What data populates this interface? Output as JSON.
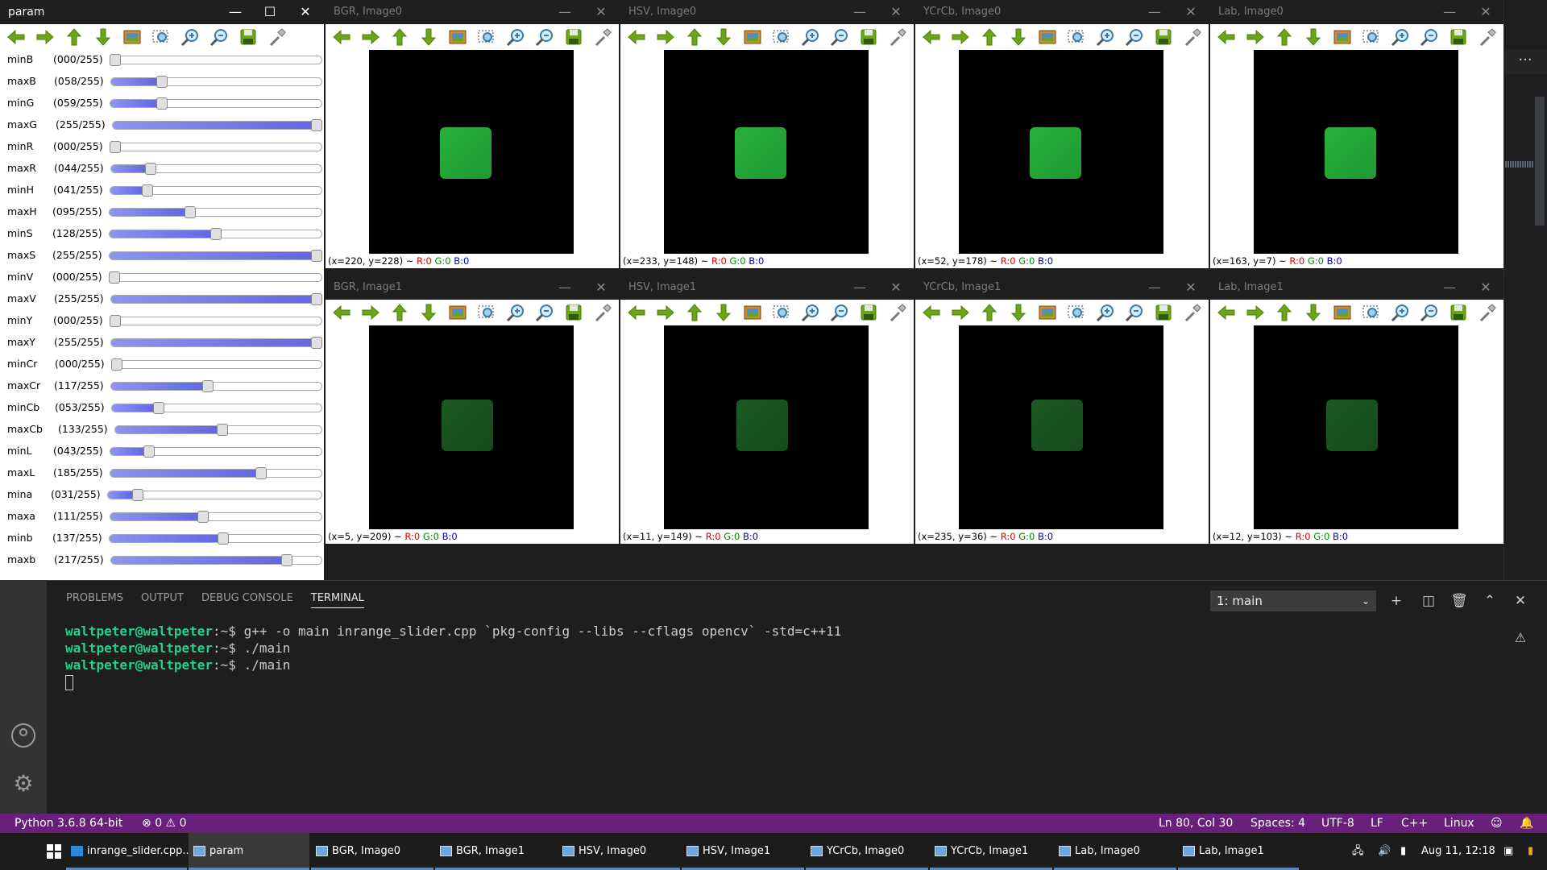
{
  "param_window": {
    "title": "param",
    "sliders": [
      {
        "name": "minB",
        "value": "(000/255)",
        "level": 0.0
      },
      {
        "name": "maxB",
        "value": "(058/255)",
        "level": 0.227
      },
      {
        "name": "minG",
        "value": "(059/255)",
        "level": 0.231
      },
      {
        "name": "maxG",
        "value": "(255/255)",
        "level": 1.0
      },
      {
        "name": "minR",
        "value": "(000/255)",
        "level": 0.0
      },
      {
        "name": "maxR",
        "value": "(044/255)",
        "level": 0.173
      },
      {
        "name": "minH",
        "value": "(041/255)",
        "level": 0.161
      },
      {
        "name": "maxH",
        "value": "(095/255)",
        "level": 0.373
      },
      {
        "name": "minS",
        "value": "(128/255)",
        "level": 0.502
      },
      {
        "name": "maxS",
        "value": "(255/255)",
        "level": 1.0
      },
      {
        "name": "minV",
        "value": "(000/255)",
        "level": 0.0
      },
      {
        "name": "maxV",
        "value": "(255/255)",
        "level": 1.0
      },
      {
        "name": "minY",
        "value": "(000/255)",
        "level": 0.0
      },
      {
        "name": "maxY",
        "value": "(255/255)",
        "level": 1.0
      },
      {
        "name": "minCr",
        "value": "(000/255)",
        "level": 0.0
      },
      {
        "name": "maxCr",
        "value": "(117/255)",
        "level": 0.459
      },
      {
        "name": "minCb",
        "value": "(053/255)",
        "level": 0.208
      },
      {
        "name": "maxCb",
        "value": "(133/255)",
        "level": 0.522
      },
      {
        "name": "minL",
        "value": "(043/255)",
        "level": 0.169
      },
      {
        "name": "maxL",
        "value": "(185/255)",
        "level": 0.725
      },
      {
        "name": "mina",
        "value": "(031/255)",
        "level": 0.122
      },
      {
        "name": "maxa",
        "value": "(111/255)",
        "level": 0.435
      },
      {
        "name": "minb",
        "value": "(137/255)",
        "level": 0.537
      },
      {
        "name": "maxb",
        "value": "(217/255)",
        "level": 0.851
      }
    ]
  },
  "image_windows": [
    {
      "title": "BGR, Image0",
      "coords": "(x=220, y=228) ~",
      "r": "R:0",
      "g": "G:0",
      "b": "B:0",
      "square": "bright"
    },
    {
      "title": "HSV, Image0",
      "coords": "(x=233, y=148) ~",
      "r": "R:0",
      "g": "G:0",
      "b": "B:0",
      "square": "bright"
    },
    {
      "title": "YCrCb, Image0",
      "coords": "(x=52, y=178) ~",
      "r": "R:0",
      "g": "G:0",
      "b": "B:0",
      "square": "bright"
    },
    {
      "title": "Lab, Image0",
      "coords": "(x=163, y=7) ~",
      "r": "R:0",
      "g": "G:0",
      "b": "B:0",
      "square": "bright"
    },
    {
      "title": "BGR, Image1",
      "coords": "(x=5, y=209) ~",
      "r": "R:0",
      "g": "G:0",
      "b": "B:0",
      "square": "dark"
    },
    {
      "title": "HSV, Image1",
      "coords": "(x=11, y=149) ~",
      "r": "R:0",
      "g": "G:0",
      "b": "B:0",
      "square": "dark"
    },
    {
      "title": "YCrCb, Image1",
      "coords": "(x=235, y=36) ~",
      "r": "R:0",
      "g": "G:0",
      "b": "B:0",
      "square": "dark"
    },
    {
      "title": "Lab, Image1",
      "coords": "(x=12, y=103) ~",
      "r": "R:0",
      "g": "G:0",
      "b": "B:0",
      "square": "dark"
    }
  ],
  "panel": {
    "tabs": [
      "PROBLEMS",
      "OUTPUT",
      "DEBUG CONSOLE",
      "TERMINAL"
    ],
    "active_tab": "TERMINAL",
    "terminal_select": "1: main",
    "lines": [
      {
        "user": "waltpeter@waltpeter",
        "prompt": ":~$ ",
        "cmd": "g++ -o main inrange_slider.cpp `pkg-config --libs --cflags opencv` -std=c++11"
      },
      {
        "user": "waltpeter@waltpeter",
        "prompt": ":~$ ",
        "cmd": "./main"
      },
      {
        "user": "waltpeter@waltpeter",
        "prompt": ":~$ ",
        "cmd": "./main"
      }
    ]
  },
  "statusbar": {
    "python": "Python 3.6.8 64-bit",
    "errors": "0",
    "warnings": "0",
    "position": "Ln 80, Col 30",
    "spaces": "Spaces: 4",
    "encoding": "UTF-8",
    "eol": "LF",
    "language": "C++",
    "os": "Linux",
    "bar_color": "#68217a"
  },
  "taskbar": {
    "items": [
      {
        "label": "inrange_slider.cpp...",
        "icon": "vscode-icon",
        "active": false
      },
      {
        "label": "param",
        "icon": "window-icon",
        "active": true
      },
      {
        "label": "BGR, Image0",
        "icon": "window-icon",
        "active": false
      },
      {
        "label": "BGR, Image1",
        "icon": "window-icon",
        "active": false
      },
      {
        "label": "HSV, Image0",
        "icon": "window-icon",
        "active": false
      },
      {
        "label": "HSV, Image1",
        "icon": "window-icon",
        "active": false
      },
      {
        "label": "YCrCb, Image0",
        "icon": "window-icon",
        "active": false
      },
      {
        "label": "YCrCb, Image1",
        "icon": "window-icon",
        "active": false
      },
      {
        "label": "Lab, Image0",
        "icon": "window-icon",
        "active": false
      },
      {
        "label": "Lab, Image1",
        "icon": "window-icon",
        "active": false
      }
    ],
    "clock": "Aug 11, 12:18"
  },
  "toolbar_icons": [
    "arrow-left-icon",
    "arrow-right-icon",
    "arrow-up-icon",
    "arrow-down-icon",
    "fit-image-icon",
    "zoom-region-icon",
    "zoom-in-icon",
    "zoom-out-icon",
    "save-icon",
    "properties-icon"
  ]
}
